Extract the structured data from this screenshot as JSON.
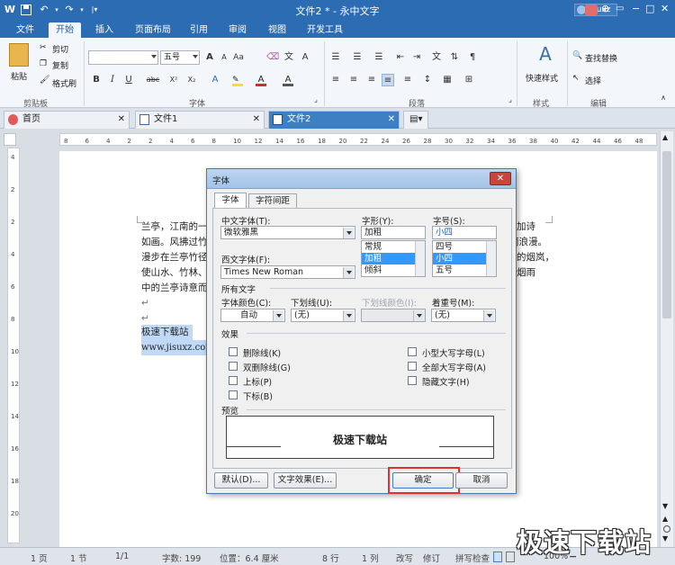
{
  "app": {
    "title": "文件2 * - 永中文字",
    "user": "jisuxz"
  },
  "menus": [
    "文件",
    "开始",
    "插入",
    "页面布局",
    "引用",
    "审阅",
    "视图",
    "开发工具"
  ],
  "ribbon": {
    "clipboard": {
      "paste": "粘贴",
      "cut": "剪切",
      "copy": "复制",
      "format_painter": "格式刷",
      "group": "剪贴板"
    },
    "font": {
      "font_name": "",
      "font_size": "五号",
      "group": "字体"
    },
    "paragraph": {
      "group": "段落"
    },
    "styles": {
      "quick_styles": "快速样式",
      "group": "样式"
    },
    "editing": {
      "find_replace": "查找替换",
      "select": "选择",
      "group": "编辑"
    }
  },
  "tabs": [
    "首页",
    "文件1",
    "文件2"
  ],
  "ruler": {
    "horizontal": [
      "8",
      "6",
      "4",
      "2",
      "2",
      "4",
      "6",
      "8",
      "10",
      "12",
      "14",
      "16",
      "18",
      "20",
      "22",
      "24",
      "26",
      "28",
      "30",
      "32",
      "34",
      "36",
      "38",
      "40",
      "42",
      "44",
      "46",
      "48"
    ],
    "vertical": [
      "4",
      "2",
      "2",
      "4",
      "6",
      "8",
      "10",
      "12",
      "14",
      "16",
      "18",
      "20"
    ]
  },
  "document": {
    "lines_left": [
      "兰亭，江南的一",
      "如画。风拂过竹",
      "漫步在兰亭竹径",
      "使山水、竹林、",
      "中的兰亭诗意而"
    ],
    "lines_right": [
      "加诗",
      "丽浪漫。",
      "的烟岚，",
      "烟雨",
      ""
    ],
    "selected_title": "极速下载站",
    "selected_url": "www.jisuxz.com"
  },
  "dialog": {
    "title": "字体",
    "tabs": [
      "字体",
      "字符间距"
    ],
    "cn_font_label": "中文字体(T):",
    "cn_font_value": "微软雅黑",
    "style_label": "字形(Y):",
    "style_value": "加粗",
    "style_options": [
      "常规",
      "加粗",
      "倾斜"
    ],
    "size_label": "字号(S):",
    "size_value": "小四",
    "size_options": [
      "四号",
      "小四",
      "五号"
    ],
    "west_font_label": "西文字体(F):",
    "west_font_value": "Times New Roman",
    "all_text_label": "所有文字",
    "font_color_label": "字体颜色(C):",
    "font_color_value": "自动",
    "underline_label": "下划线(U):",
    "underline_value": "(无)",
    "underline_color_label": "下划线颜色(I):",
    "emphasis_label": "着重号(M):",
    "emphasis_value": "(无)",
    "effects_label": "效果",
    "effects_left": [
      "删除线(K)",
      "双删除线(G)",
      "上标(P)",
      "下标(B)"
    ],
    "effects_right": [
      "小型大写字母(L)",
      "全部大写字母(A)",
      "隐藏文字(H)"
    ],
    "preview_label": "预览",
    "preview_text": "极速下载站",
    "btn_default": "默认(D)...",
    "btn_text_effect": "文字效果(E)...",
    "btn_ok": "确定",
    "btn_cancel": "取消"
  },
  "status": {
    "page": "1 页",
    "section": "1 节",
    "pages": "1/1",
    "words": "字数: 199",
    "position": "位置：6.4 厘米",
    "line": "8 行",
    "column": "1 列",
    "overtype": "改写",
    "revise": "修订",
    "spellcheck": "拼写检查",
    "zoom": "100%"
  },
  "watermark": "极速下载站",
  "colors": {
    "title_blue": "#2b6cb3",
    "highlight_red": "#e0312f",
    "selection": "#bfd9f7"
  }
}
